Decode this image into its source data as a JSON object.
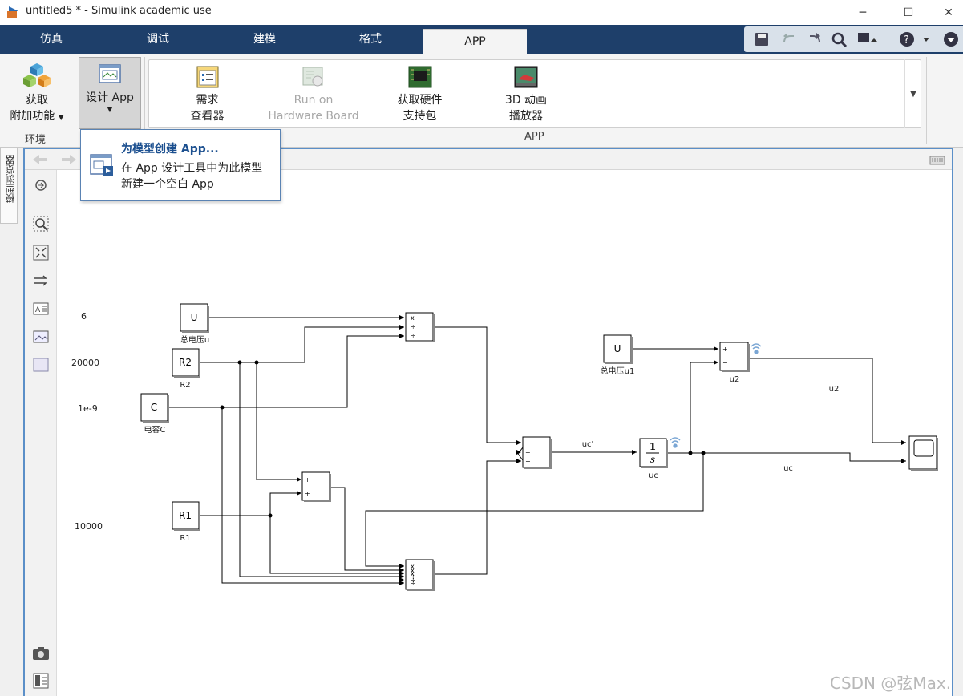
{
  "window": {
    "title": "untitled5 * - Simulink academic use",
    "minimize": "─",
    "maximize": "☐",
    "close": "✕"
  },
  "tabs": [
    "仿真",
    "调试",
    "建模",
    "格式",
    "APP"
  ],
  "ribbon": {
    "get_addons": {
      "line1": "获取",
      "line2": "附加功能"
    },
    "design_app": {
      "label": "设计 App"
    },
    "section_env": "环境",
    "section_app": "APP",
    "gallery": [
      {
        "line1": "需求",
        "line2": "查看器",
        "enabled": true
      },
      {
        "line1": "Run on",
        "line2": "Hardware Board",
        "enabled": false
      },
      {
        "line1": "获取硬件",
        "line2": "支持包",
        "enabled": true
      },
      {
        "line1": "3D 动画",
        "line2": "播放器",
        "enabled": true
      }
    ]
  },
  "dropdown": {
    "heading": "为模型创建 App...",
    "line1": "在 App 设计工具中为此模型",
    "line2": "新建一个空白 App"
  },
  "side_tab": "模型浏览器",
  "model": {
    "values": {
      "u": "6",
      "r2": "20000",
      "c": "1e-9",
      "r1": "10000"
    },
    "blocks": {
      "U": "U",
      "U_label": "总电压u",
      "R2": "R2",
      "R2_label": "R2",
      "C": "C",
      "C_label": "电容C",
      "R1": "R1",
      "R1_label": "R1",
      "U1": "U",
      "U1_label": "总电压u1",
      "sum2_label": "u2",
      "int_num": "1",
      "int_den": "s",
      "int_label": "uc"
    },
    "signals": {
      "ucp": "uc'",
      "uc": "uc",
      "u2": "u2"
    }
  },
  "watermark": "CSDN @弦Max."
}
